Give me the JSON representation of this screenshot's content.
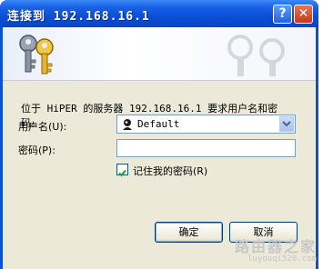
{
  "dialog": {
    "title": "连接到 192.168.16.1",
    "help_button": "?",
    "close_button": "✕",
    "message": "位于 HiPER 的服务器 192.168.16.1 要求用户名和密码。",
    "username_label": "用户名(U):",
    "username_value": "Default",
    "password_label": "密码(P):",
    "password_value": "",
    "remember_checked": true,
    "remember_label": "记住我的密码(R)",
    "ok_button": "确定",
    "cancel_button": "取消"
  },
  "watermark": {
    "text": "路由器之家",
    "url": "luyouqi520.com"
  },
  "colors": {
    "titlebar": "#0a4fd8",
    "client": "#ece9d8",
    "close": "#c4391a"
  }
}
